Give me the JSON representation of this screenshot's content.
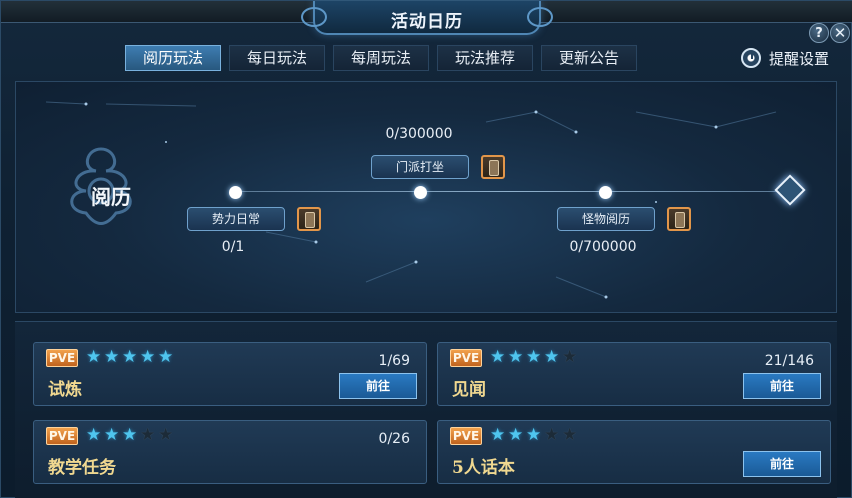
{
  "window": {
    "title": "活动日历"
  },
  "controls": {
    "help": "?",
    "close": "✕"
  },
  "tabs": [
    {
      "label": "阅历玩法",
      "active": true
    },
    {
      "label": "每日玩法",
      "active": false
    },
    {
      "label": "每周玩法",
      "active": false
    },
    {
      "label": "玩法推荐",
      "active": false
    },
    {
      "label": "更新公告",
      "active": false
    }
  ],
  "remind": {
    "label": "提醒设置",
    "icon": "clock-icon"
  },
  "yueli": {
    "title": "阅历",
    "nodes": [
      {
        "label": "势力日常",
        "progress": "0/1"
      },
      {
        "label": "门派打坐",
        "progress": "0/300000"
      },
      {
        "label": "怪物阅历",
        "progress": "0/700000"
      }
    ],
    "end_icon": "diamond-seal-icon"
  },
  "activities": [
    {
      "tag": "PVE",
      "stars": 5,
      "max_stars": 5,
      "name": "试炼",
      "count": "1/69",
      "button": "前往"
    },
    {
      "tag": "PVE",
      "stars": 4,
      "max_stars": 5,
      "name": "见闻",
      "count": "21/146",
      "button": "前往"
    },
    {
      "tag": "PVE",
      "stars": 3,
      "max_stars": 5,
      "name": "教学任务",
      "count": "0/26",
      "button": null
    },
    {
      "tag": "PVE",
      "stars": 3,
      "max_stars": 5,
      "name": "5人话本",
      "count": "",
      "button": "前往"
    }
  ],
  "colors": {
    "accent": "#4fc5ee",
    "tab_active": "#3e7db1",
    "pve_tag": "#e0883a",
    "activity_name": "#f0d890"
  }
}
